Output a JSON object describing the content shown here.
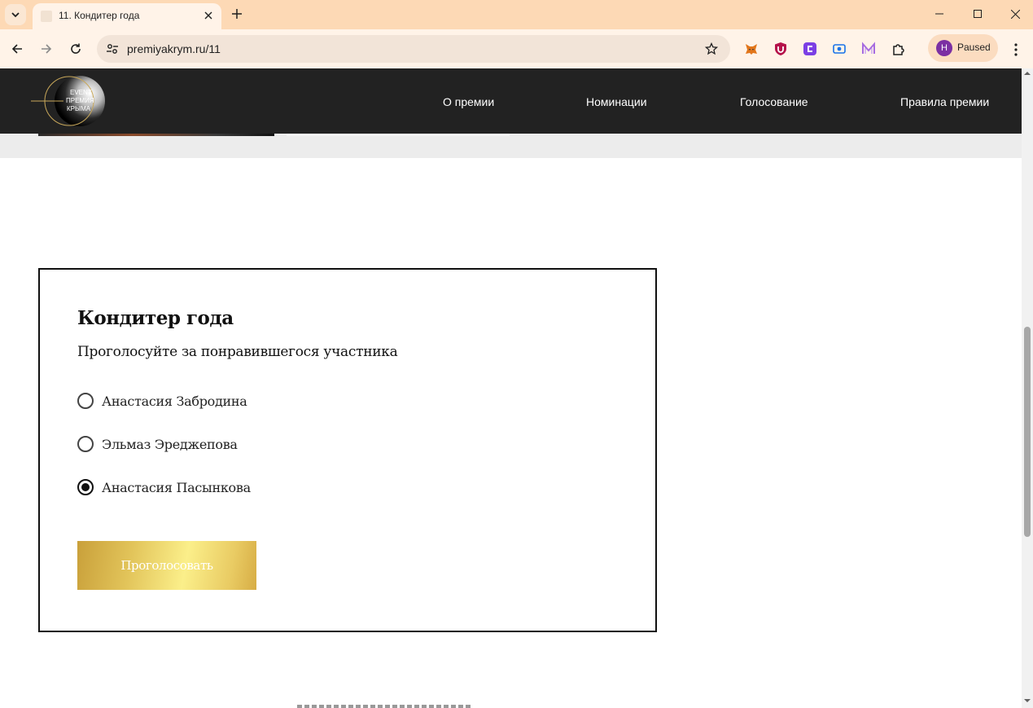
{
  "browser": {
    "tab_title": "11. Кондитер года",
    "url": "premiyakrym.ru/11",
    "profile_initial": "H",
    "profile_status": "Paused",
    "icons": [
      "tab-search-icon",
      "close-icon",
      "plus-icon",
      "minimize-icon",
      "maximize-icon",
      "window-close-icon",
      "back-arrow-icon",
      "forward-arrow-icon",
      "reload-icon",
      "site-settings-icon",
      "bookmark-star-icon",
      "metamask-fox-icon",
      "ublock-shield-icon",
      "extension-purple-icon",
      "extension-blue-icon",
      "extension-m-icon",
      "puzzle-extensions-icon",
      "kebab-menu-icon"
    ]
  },
  "site": {
    "logo": {
      "line1": "EVENT",
      "line2": "ПРЕМИЯ",
      "line3": "КРЫМА"
    },
    "nav": [
      {
        "label": "О премии"
      },
      {
        "label": "Номинации"
      },
      {
        "label": "Голосование"
      },
      {
        "label": "Правила премии"
      }
    ]
  },
  "vote": {
    "title": "Кондитер года",
    "subtitle": "Проголосуйте за понравившегося участника",
    "options": [
      {
        "label": "Анастасия Забродина",
        "selected": false
      },
      {
        "label": "Эльмаз Эреджепова",
        "selected": false
      },
      {
        "label": "Анастасия Пасынкова",
        "selected": true
      }
    ],
    "submit_label": "Проголосовать"
  },
  "colors": {
    "header_bg": "#222222",
    "tab_strip": "#fdd9b5",
    "gold_gradient": [
      "#c9a03a",
      "#fbef8a",
      "#d7ad45"
    ]
  }
}
